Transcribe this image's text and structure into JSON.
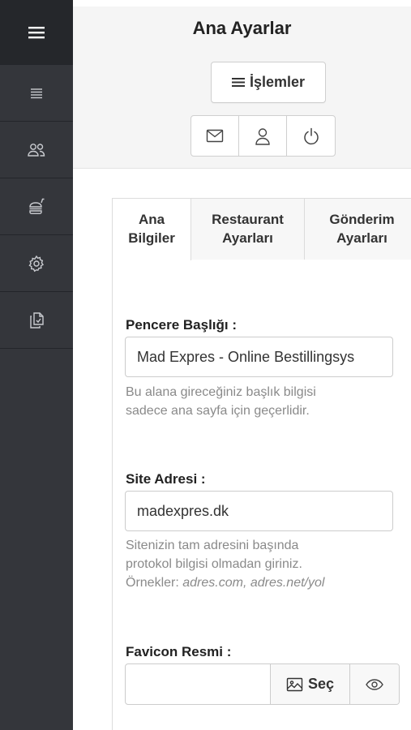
{
  "sidebar": {
    "items": [
      {
        "icon": "hamburger-icon"
      },
      {
        "icon": "list-icon"
      },
      {
        "icon": "users-icon"
      },
      {
        "icon": "burger-drink-icon"
      },
      {
        "icon": "gear-icon"
      },
      {
        "icon": "documents-icon"
      }
    ]
  },
  "header": {
    "title": "Ana Ayarlar",
    "ops_label": "İşlemler",
    "buttons": [
      {
        "icon": "mail-icon"
      },
      {
        "icon": "user-icon"
      },
      {
        "icon": "power-icon"
      }
    ]
  },
  "tabs": [
    {
      "line1": "Ana",
      "line2": "Bilgiler",
      "active": true
    },
    {
      "line1": "Restaurant",
      "line2": "Ayarları",
      "active": false
    },
    {
      "line1": "Gönderim",
      "line2": "Ayarları",
      "active": false
    }
  ],
  "form": {
    "window_title": {
      "label": "Pencere Başlığı :",
      "value": "Mad Expres - Online Bestillingsys",
      "help_line1": "Bu alana gireceğiniz başlık bilgisi",
      "help_line2": "sadece ana sayfa için geçerlidir."
    },
    "site_address": {
      "label": "Site Adresi :",
      "value": "madexpres.dk",
      "help_line1": "Sitenizin tam adresini başında",
      "help_line2": "protokol bilgisi olmadan giriniz.",
      "help_examples_prefix": "Örnekler: ",
      "help_examples": "adres.com, adres.net/yol"
    },
    "favicon": {
      "label": "Favicon Resmi :",
      "value": "",
      "select_label": "Seç"
    }
  }
}
